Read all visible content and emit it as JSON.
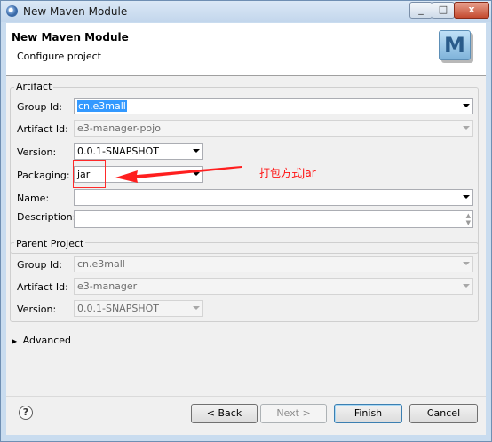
{
  "window": {
    "title": "New Maven Module",
    "minimize": "_",
    "maximize": "□",
    "close": "x"
  },
  "header": {
    "title": "New Maven Module",
    "subtitle": "Configure project",
    "logo_letter": "M"
  },
  "artifact": {
    "legend": "Artifact",
    "group_id_label": "Group Id:",
    "group_id_value": "cn.e3mall",
    "artifact_id_label": "Artifact Id:",
    "artifact_id_value": "e3-manager-pojo",
    "version_label": "Version:",
    "version_value": "0.0.1-SNAPSHOT",
    "packaging_label": "Packaging:",
    "packaging_value": "jar",
    "name_label": "Name:",
    "name_value": "",
    "description_label": "Description:",
    "description_value": ""
  },
  "annotation": {
    "text": "打包方式jar",
    "color": "#ff1010"
  },
  "parent": {
    "legend": "Parent Project",
    "group_id_label": "Group Id:",
    "group_id_value": "cn.e3mall",
    "artifact_id_label": "Artifact Id:",
    "artifact_id_value": "e3-manager",
    "version_label": "Version:",
    "version_value": "0.0.1-SNAPSHOT"
  },
  "advanced": {
    "label": "Advanced"
  },
  "buttons": {
    "back": "< Back",
    "next": "Next >",
    "finish": "Finish",
    "cancel": "Cancel",
    "help": "?"
  }
}
